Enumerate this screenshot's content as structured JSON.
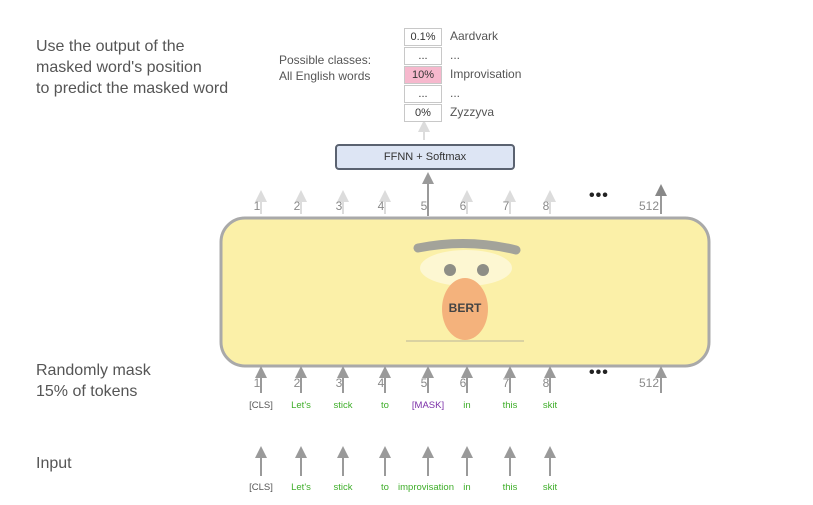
{
  "text": {
    "caption_lines": [
      "Use the output of the",
      "masked word's position",
      "to predict the masked word"
    ],
    "mask_caption_lines": [
      "Randomly mask",
      "15% of tokens"
    ],
    "input_caption": "Input",
    "classes_label_lines": [
      "Possible classes:",
      "All English words"
    ],
    "ffnn_label": "FFNN + Softmax",
    "bert_label": "BERT",
    "ellipsis": "•••"
  },
  "probabilities": [
    {
      "value": "0.1%",
      "word": "Aardvark",
      "highlight": false
    },
    {
      "value": "...",
      "word": "...",
      "highlight": false
    },
    {
      "value": "10%",
      "word": "Improvisation",
      "highlight": true
    },
    {
      "value": "...",
      "word": "...",
      "highlight": false
    },
    {
      "value": "0%",
      "word": "Zyzzyva",
      "highlight": false
    }
  ],
  "positions": [
    "1",
    "2",
    "3",
    "4",
    "5",
    "6",
    "7",
    "8"
  ],
  "last_position": "512",
  "masked_tokens": [
    {
      "text": "[CLS]",
      "color": "#555555"
    },
    {
      "text": "Let's",
      "color": "#3fae2a"
    },
    {
      "text": "stick",
      "color": "#3fae2a"
    },
    {
      "text": "to",
      "color": "#3fae2a"
    },
    {
      "text": "[MASK]",
      "color": "#7b2fa8"
    },
    {
      "text": "in",
      "color": "#3fae2a"
    },
    {
      "text": "this",
      "color": "#3fae2a"
    },
    {
      "text": "skit",
      "color": "#3fae2a"
    }
  ],
  "input_tokens": [
    {
      "text": "[CLS]",
      "color": "#555555"
    },
    {
      "text": "Let's",
      "color": "#3fae2a"
    },
    {
      "text": "stick",
      "color": "#3fae2a"
    },
    {
      "text": "to",
      "color": "#3fae2a"
    },
    {
      "text": "improvisation",
      "color": "#3fae2a"
    },
    {
      "text": "in",
      "color": "#3fae2a"
    },
    {
      "text": "this",
      "color": "#3fae2a"
    },
    {
      "text": "skit",
      "color": "#3fae2a"
    }
  ],
  "colors": {
    "bert_body": "#fbf0a8",
    "bert_border": "#a9a9a9",
    "nose": "#f4b27c",
    "highlight": "#f6b8cd",
    "ffnn_fill": "#dde5f4"
  }
}
